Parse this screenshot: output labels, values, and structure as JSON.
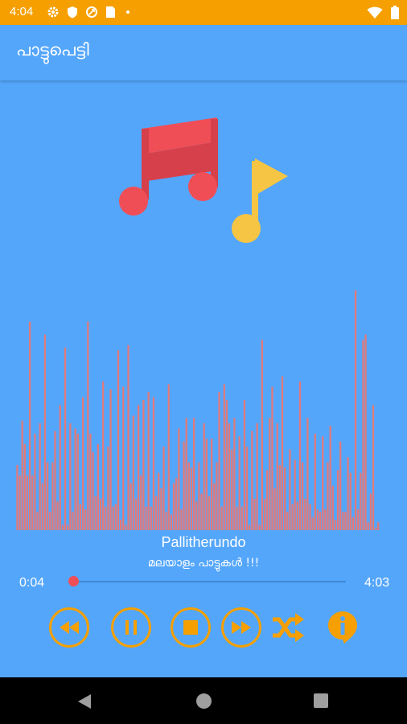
{
  "status_bar": {
    "time": "4:04",
    "left_icons": [
      "gear-icon",
      "shield-icon",
      "data-saver-icon",
      "sim-card-icon",
      "dot-icon"
    ],
    "right_icons": [
      "wifi-icon",
      "battery-icon"
    ],
    "color": "#f5a000"
  },
  "app_bar": {
    "title": "പാട്ടുപെട്ടി"
  },
  "theme": {
    "background": "#54a6fb",
    "accent": "#f5a000",
    "note_red": "#ef4e57",
    "note_yellow": "#f6c543",
    "visualizer": "#e27a7a"
  },
  "visualizer": {
    "levels": [
      0.25,
      0.21,
      0.42,
      0.33,
      0.21,
      0.8,
      0.21,
      0.37,
      0.07,
      0.41,
      0.18,
      0.75,
      0.26,
      0.07,
      0.26,
      0.38,
      0.11,
      0.48,
      0.02,
      0.7,
      0.02,
      0.41,
      0.07,
      0.39,
      0.37,
      0.1,
      0.51,
      0.08,
      0.8,
      0.37,
      0.3,
      0.13,
      0.33,
      0.12,
      0.57,
      0.09,
      0.32,
      0.54,
      0.09,
      0.1,
      0.69,
      0.04,
      0.55,
      0.02,
      0.71,
      0.18,
      0.44,
      0.12,
      0.48,
      0.21,
      0.5,
      0.09,
      0.53,
      0.09,
      0.51,
      0.13,
      0.22,
      0.16,
      0.32,
      0.07,
      0.56,
      0.06,
      0.18,
      0.2,
      0.39,
      0.08,
      0.34,
      0.43,
      0.26,
      0.24,
      0.43,
      0.11,
      0.26,
      0.14,
      0.41,
      0.35,
      0.13,
      0.35,
      0.18,
      0.26,
      0.53,
      0.09,
      0.56,
      0.5,
      0.41,
      0.31,
      0.43,
      0.09,
      0.36,
      0.09,
      0.5,
      0.32,
      0.02,
      0.38,
      0.12,
      0.41,
      0.02,
      0.73,
      0.12,
      0.23,
      0.43,
      0.55,
      0.16,
      0.41,
      0.25,
      0.59,
      0.24,
      0.07,
      0.31,
      0.1,
      0.27,
      0.11,
      0.57,
      0.26,
      0.12,
      0.43,
      0.1,
      0.05,
      0.37,
      0.08,
      0.07,
      0.36,
      0.08,
      0.26,
      0.4,
      0.17,
      0.04,
      0.23,
      0.34,
      0.07,
      0.07,
      0.28,
      0.22,
      0.05,
      0.92,
      0.08,
      0.22,
      0.73,
      0.75,
      0.03,
      0.14,
      0.48,
      0.01,
      0.03
    ]
  },
  "track": {
    "title": "Pallitherundo",
    "subtitle": "മലയാളം പാട്ടുകൾ  !!!",
    "elapsed": "0:04",
    "duration": "4:03",
    "progress": 0.016
  },
  "controls": {
    "icons": [
      "rewind-icon",
      "pause-icon",
      "stop-icon",
      "fast-forward-icon",
      "shuffle-icon",
      "info-icon"
    ]
  },
  "nav_bar": {
    "icons": [
      "back-icon",
      "home-icon",
      "recents-icon"
    ]
  }
}
